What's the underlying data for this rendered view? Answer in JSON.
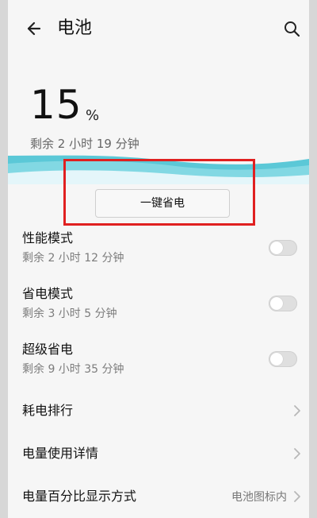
{
  "header": {
    "title": "电池"
  },
  "battery": {
    "percent": "15",
    "percent_symbol": "%",
    "remaining": "剩余 2 小时 19 分钟"
  },
  "actions": {
    "one_click": "一键省电"
  },
  "modes": [
    {
      "title": "性能模式",
      "subtitle": "剩余 2 小时 12 分钟"
    },
    {
      "title": "省电模式",
      "subtitle": "剩余 3 小时 5 分钟"
    },
    {
      "title": "超级省电",
      "subtitle": "剩余 9 小时 35 分钟"
    }
  ],
  "menu": [
    {
      "label": "耗电排行"
    },
    {
      "label": "电量使用详情"
    },
    {
      "label": "电量百分比显示方式",
      "value": "电池图标内"
    }
  ],
  "icons": {
    "back": "arrow-left-icon",
    "search": "search-icon",
    "chevron": "chevron-right-icon"
  },
  "colors": {
    "accent": "#5bc8d7",
    "highlight": "#e02020"
  }
}
